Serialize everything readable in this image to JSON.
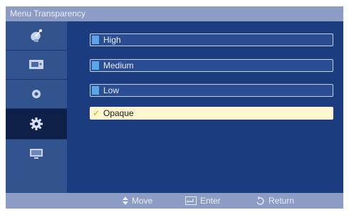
{
  "title": "Menu Transparency",
  "sidebar": {
    "items": [
      {
        "icon": "satellite-dish-icon"
      },
      {
        "icon": "picture-icon"
      },
      {
        "icon": "sound-icon"
      },
      {
        "icon": "setup-gear-icon",
        "selected": true
      },
      {
        "icon": "input-source-icon"
      }
    ]
  },
  "options": [
    {
      "label": "High",
      "selected": false
    },
    {
      "label": "Medium",
      "selected": false
    },
    {
      "label": "Low",
      "selected": false
    },
    {
      "label": "Opaque",
      "selected": true
    }
  ],
  "footer": {
    "move": "Move",
    "enter": "Enter",
    "return": "Return"
  },
  "colors": {
    "panel": "#1b3d80",
    "bar": "#8d9cc4",
    "sidebar": "#33538f",
    "selected_highlight": "#fff7cf",
    "marker": "#5aa6e6",
    "check": "#e0a000"
  }
}
